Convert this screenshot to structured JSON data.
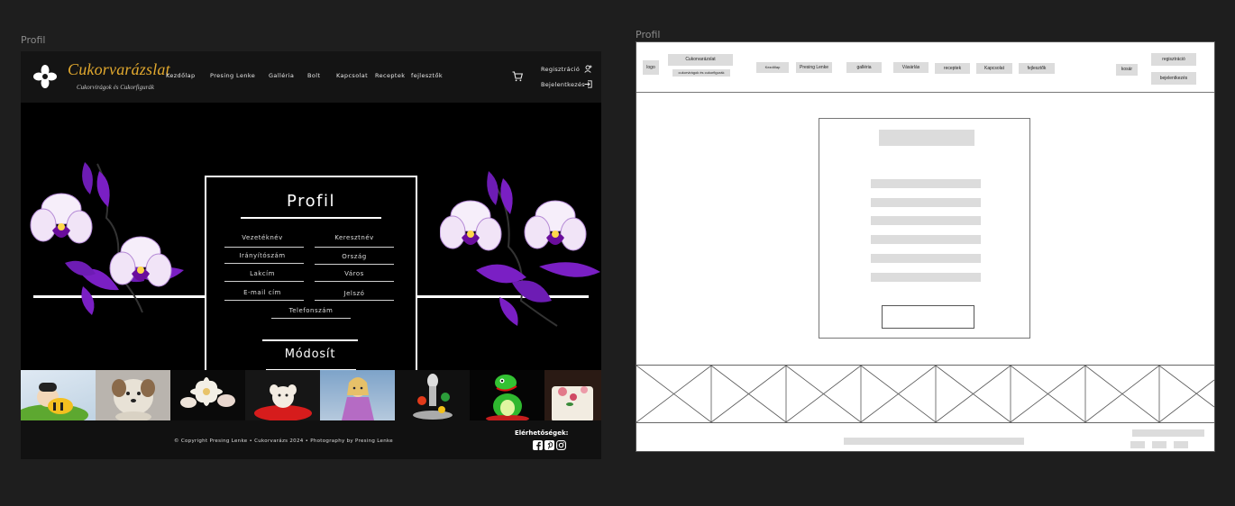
{
  "frames": {
    "left_label": "Profil",
    "right_label": "Profil"
  },
  "design": {
    "brand": {
      "title": "Cukorvarázslat",
      "subtitle": "Cukorvirágok és Cukorfigurák"
    },
    "nav": [
      "Kezdőlap",
      "Presing Lenke",
      "Galléria",
      "Bolt",
      "Kapcsolat",
      "Receptek",
      "fejlesztők"
    ],
    "auth": {
      "register": "Regisztráció",
      "login": "Bejelentkezés"
    },
    "form": {
      "title": "Profil",
      "fields": {
        "vezeteknev": "Vezetéknév",
        "keresztnev": "Keresztnév",
        "iranyitoszam": "Irányítószám",
        "orszag": "Ország",
        "lakcim": "Lakcím",
        "varos": "Város",
        "email": "E-mail cím",
        "jelszo": "Jelszó",
        "telefonszam": "Telefonszám"
      },
      "submit": "Módosít"
    },
    "footer": {
      "copyright": "© Copyright Presing Lenke • Cukorvarázs 2024 • Photography by Presing Lenke",
      "contacts_label": "Elérhetőségek:"
    },
    "colors": {
      "accent": "#e2a92e",
      "orchid": "#7a1fc4",
      "background": "#000000"
    }
  },
  "wireframe": {
    "logo": "logo",
    "brand": "Cukorvarázslat",
    "brand_sub": "cukorvirágok és cukorfigurák",
    "nav": [
      "Kezdőlap",
      "Presing Lenke",
      "galléria",
      "Vásárlás",
      "receptek",
      "Kapcsolat",
      "fejlesztők"
    ],
    "cart": "kosár",
    "register": "regisztráció",
    "login": "bejelentkezés"
  }
}
